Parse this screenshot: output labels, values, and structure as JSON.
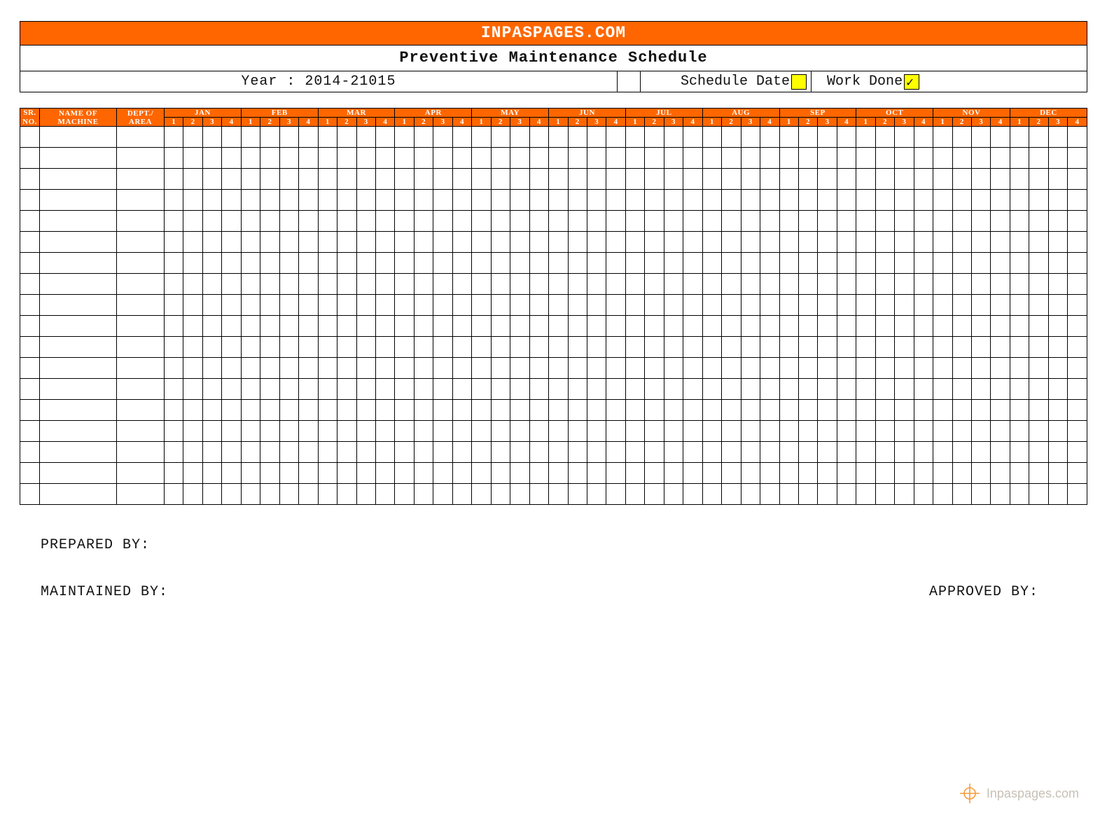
{
  "banner": "INPASPAGES.COM",
  "title": "Preventive Maintenance Schedule",
  "year_label": "Year : 2014-21015",
  "legend": {
    "schedule": "Schedule Date",
    "workdone": "Work Done",
    "check": "✓"
  },
  "columns": {
    "sr_line1": "SR.",
    "sr_line2": "NO.",
    "name_line1": "NAME OF",
    "name_line2": "MACHINE",
    "dept_line1": "DEPT./",
    "dept_line2": "AREA"
  },
  "months": [
    "JAN",
    "FEB",
    "MAR",
    "APR",
    "MAY",
    "JUN",
    "JUL",
    "AUG",
    "SEP",
    "OCT",
    "NOV",
    "DEC"
  ],
  "weeks": [
    "1",
    "2",
    "3",
    "4"
  ],
  "body_rows": 18,
  "footer": {
    "prepared": "PREPARED BY:",
    "maintained": "MAINTAINED BY:",
    "approved": "APPROVED BY:"
  },
  "watermark": "Inpaspages.com"
}
